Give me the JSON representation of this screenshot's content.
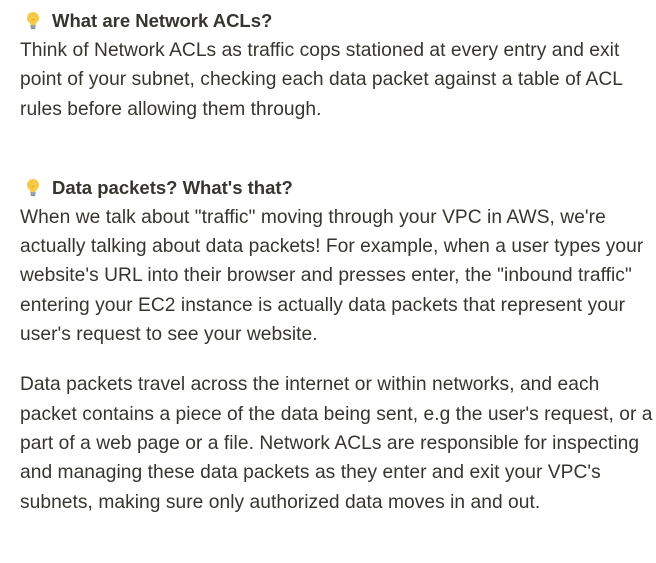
{
  "sections": [
    {
      "icon": "lightbulb-icon",
      "heading": "What are Network ACLs?",
      "paragraphs": [
        "Think of Network ACLs as traffic cops stationed at every entry and exit point of your subnet, checking each data packet against a table of ACL rules before allowing them through."
      ]
    },
    {
      "icon": "lightbulb-icon",
      "heading": "Data packets? What's that?",
      "paragraphs": [
        "When we talk about \"traffic\" moving through your VPC in AWS, we're actually talking about data packets! For example, when a user types your website's URL into their browser and presses enter, the \"inbound traffic\" entering your EC2 instance is actually data packets that represent your user's request to see your website.",
        "Data packets travel across the internet or within networks, and each packet contains a piece of the data being sent, e.g the user's request, or a part of a web page or a file. Network ACLs are responsible for inspecting and managing these data packets as they enter and exit your VPC's subnets, making sure only authorized data moves in and out."
      ]
    }
  ],
  "colors": {
    "text": "#37352f",
    "bulb_yellow": "#f7c948",
    "bulb_base": "#9aa3ad",
    "background": "#ffffff"
  }
}
